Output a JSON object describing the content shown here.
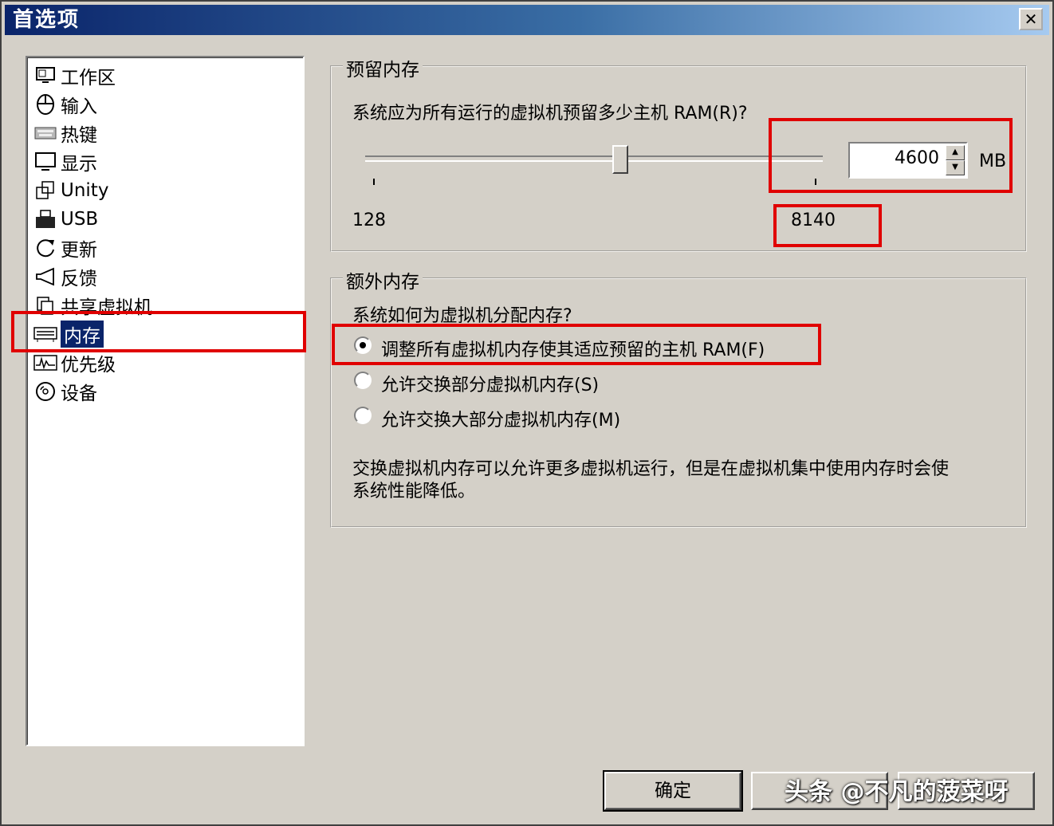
{
  "window": {
    "title": "首选项",
    "close_label": "✕"
  },
  "sidebar": {
    "items": [
      {
        "label": "工作区",
        "icon": "workspace-icon"
      },
      {
        "label": "输入",
        "icon": "mouse-icon"
      },
      {
        "label": "热键",
        "icon": "keyboard-icon"
      },
      {
        "label": "显示",
        "icon": "monitor-icon"
      },
      {
        "label": "Unity",
        "icon": "unity-windows-icon"
      },
      {
        "label": "USB",
        "icon": "usb-icon"
      },
      {
        "label": "更新",
        "icon": "refresh-icon"
      },
      {
        "label": "反馈",
        "icon": "megaphone-icon"
      },
      {
        "label": "共享虚拟机",
        "icon": "shared-vm-icon"
      },
      {
        "label": "内存",
        "icon": "memory-icon",
        "selected": true
      },
      {
        "label": "优先级",
        "icon": "priority-chart-icon"
      },
      {
        "label": "设备",
        "icon": "disc-icon"
      }
    ]
  },
  "reserved_memory": {
    "group_title": "预留内存",
    "question": "系统应为所有运行的虚拟机预留多少主机 RAM(R)?",
    "slider_min_label": "128",
    "slider_max_label": "8140",
    "slider_min": 128,
    "slider_max": 8140,
    "value": "4600",
    "unit": "MB"
  },
  "extra_memory": {
    "group_title": "额外内存",
    "question": "系统如何为虚拟机分配内存?",
    "options": [
      {
        "label": "调整所有虚拟机内存使其适应预留的主机 RAM(F)",
        "checked": true
      },
      {
        "label": "允许交换部分虚拟机内存(S)",
        "checked": false
      },
      {
        "label": "允许交换大部分虚拟机内存(M)",
        "checked": false
      }
    ],
    "note_line1": "交换虚拟机内存可以允许更多虚拟机运行，但是在虚拟机集中使用内存时会使",
    "note_line2": "系统性能降低。"
  },
  "buttons": {
    "ok": "确定",
    "cancel": ""
  },
  "watermark": "头条 @不凡的菠菜呀",
  "colors": {
    "highlight_box": "#e00000",
    "selection": "#0a246a",
    "dialog_bg": "#d4d0c8"
  }
}
